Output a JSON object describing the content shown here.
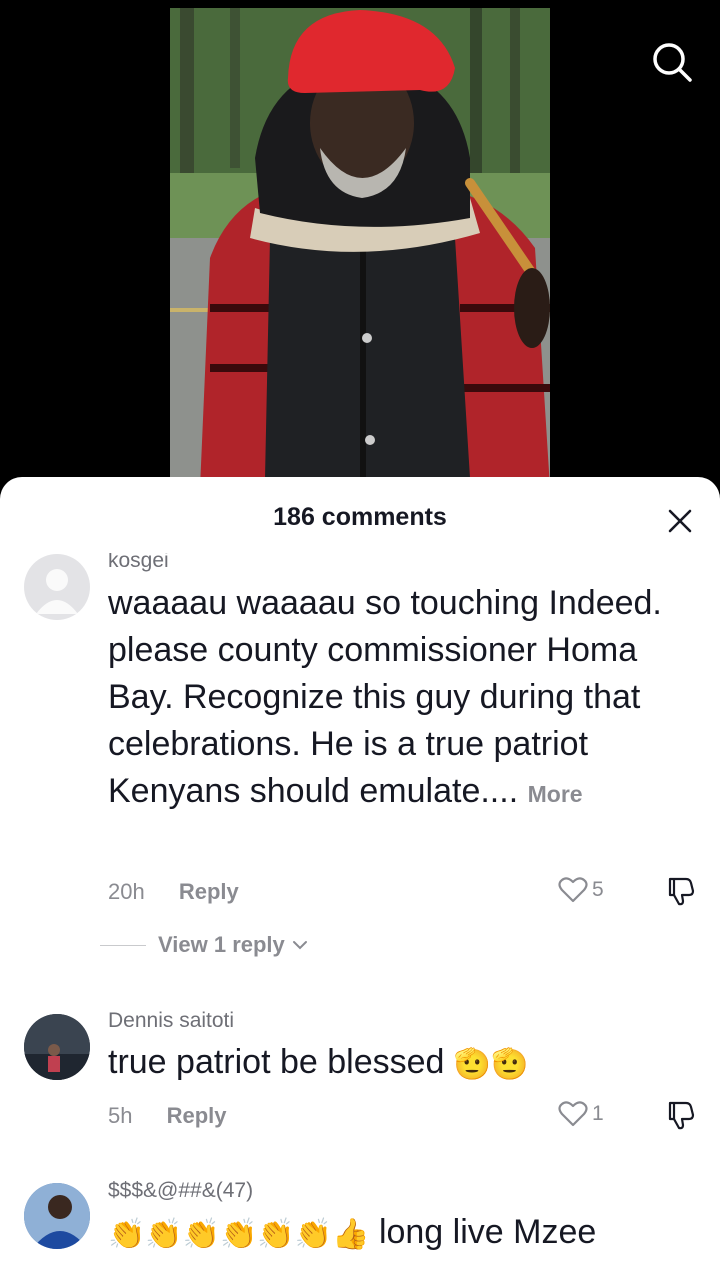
{
  "sheet": {
    "count_label": "186 comments"
  },
  "icons": {
    "search": "search-icon",
    "close": "close-icon",
    "like": "heart-icon",
    "dislike": "thumbs-down-icon"
  },
  "colors": {
    "text_primary": "#161823",
    "text_secondary": "#8a8b91",
    "sheet_bg": "#ffffff",
    "background": "#000000"
  },
  "comments": [
    {
      "user": "kosgei",
      "text": "waaaau waaaau so touching Indeed. please county commissioner Homa Bay. Recognize this guy during that celebrations. He is a true patriot Kenyans should emulate....",
      "more": "More",
      "time": "20h",
      "reply": "Reply",
      "likes": "5",
      "view_replies": "View 1 reply"
    },
    {
      "user": "Dennis saitoti",
      "text": "true patriot be blessed",
      "emoji": "🫡🫡",
      "time": "5h",
      "reply": "Reply",
      "likes": "1"
    },
    {
      "user": "$$$&@##&(47)",
      "emoji": "👏👏👏👏👏👏👍",
      "text": "long live Mzee"
    }
  ]
}
